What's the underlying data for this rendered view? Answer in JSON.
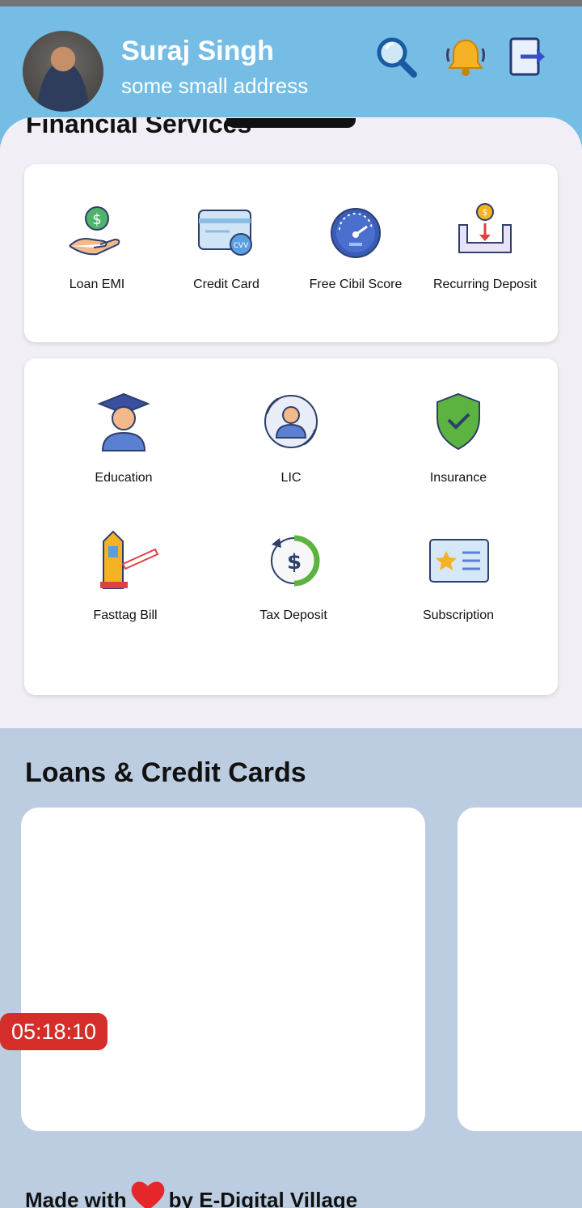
{
  "user": {
    "name": "Suraj Singh",
    "address": "some small address"
  },
  "header_icons": [
    "search-icon",
    "bell-icon",
    "logout-icon"
  ],
  "financial": {
    "title": "Financial Services",
    "row1": [
      {
        "label": "Loan EMI",
        "icon": "loan-emi-icon"
      },
      {
        "label": "Credit\nCard",
        "icon": "credit-card-icon"
      },
      {
        "label": "Free Cibil\nScore",
        "icon": "speedometer-icon"
      },
      {
        "label": "Recurring\nDeposit",
        "icon": "deposit-icon"
      }
    ],
    "row2": [
      {
        "label": "Education",
        "icon": "graduation-icon"
      },
      {
        "label": "LIC",
        "icon": "lic-icon"
      },
      {
        "label": "Insurance",
        "icon": "shield-check-icon"
      }
    ],
    "row3": [
      {
        "label": "Fasttag\nBill",
        "icon": "toll-gate-icon"
      },
      {
        "label": "Tax\nDeposit",
        "icon": "tax-dollar-icon"
      },
      {
        "label": "Subscription",
        "icon": "subscription-card-icon"
      }
    ]
  },
  "loans": {
    "title": "Loans & Credit Cards"
  },
  "timer": "05:18:10",
  "footer": {
    "prefix": "Made with",
    "suffix": "by E-Digital Village"
  },
  "colors": {
    "header": "#75bde4",
    "sheet": "#f1eff5",
    "lower_bg": "#bccde1",
    "timer": "#d42d2a",
    "heart": "#e5262a"
  }
}
